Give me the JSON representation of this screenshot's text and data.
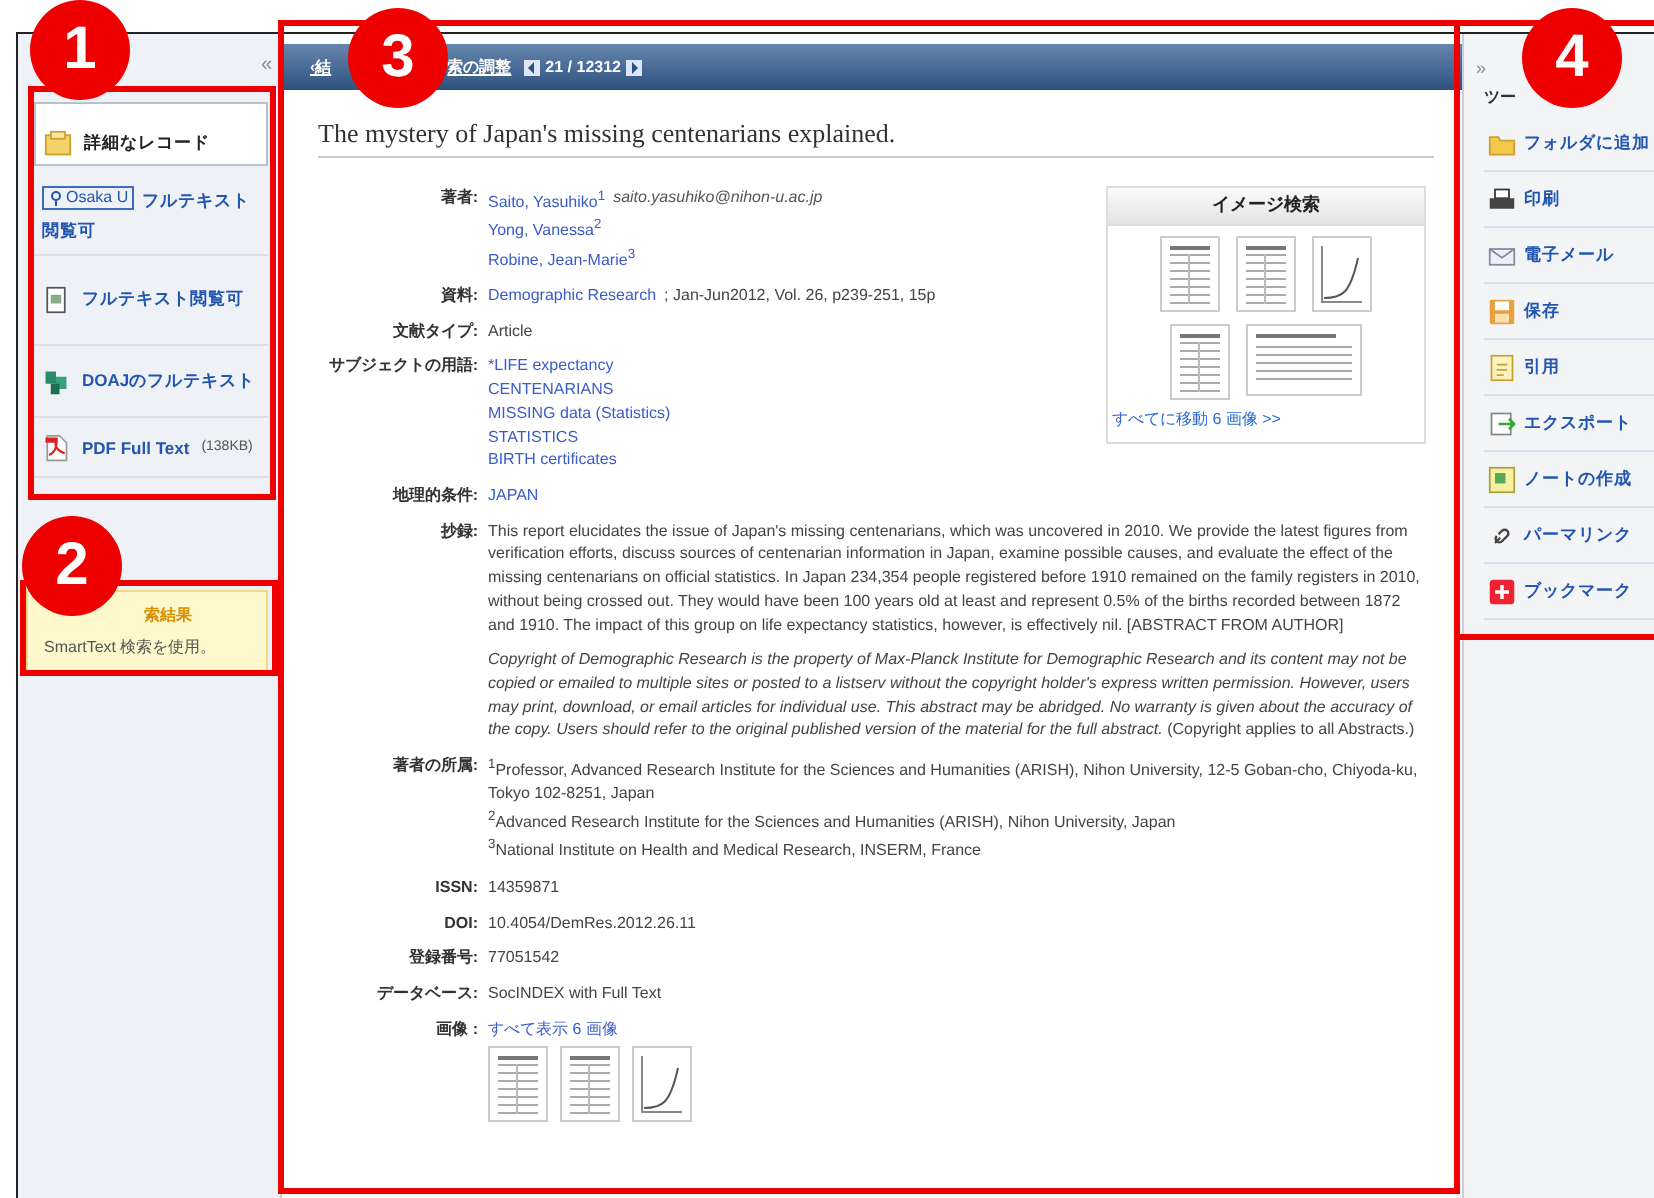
{
  "annotations": [
    {
      "number": "1"
    },
    {
      "number": "2"
    },
    {
      "number": "3"
    },
    {
      "number": "4"
    }
  ],
  "left_panel": {
    "collapse": "«",
    "items": [
      {
        "kind": "record",
        "label": "詳細なレコード",
        "selected": true
      },
      {
        "kind": "library",
        "badge": "Osaka U",
        "label": "フルテキスト閲覧可",
        "selected": false
      },
      {
        "kind": "fulltext",
        "label": "フルテキスト閲覧可",
        "selected": false
      },
      {
        "kind": "doaj",
        "label": "DOAJのフルテキスト",
        "selected": false
      },
      {
        "kind": "pdf",
        "label": "PDF Full Text",
        "size": "(138KB)",
        "selected": false
      }
    ],
    "notice": {
      "title": "索結果",
      "text": "SmartText 検索を使用。"
    }
  },
  "header": {
    "back_link": "‹結",
    "refine_link": "索の調整",
    "counter": "21 / 12312"
  },
  "title": "The mystery of Japan's missing centenarians explained.",
  "image_panel": {
    "title": "イメージ検索",
    "thumbnails": [
      {
        "kind": "table"
      },
      {
        "kind": "table"
      },
      {
        "kind": "chart"
      },
      {
        "kind": "table"
      },
      {
        "kind": "wide-table"
      }
    ],
    "link": "すべてに移動 6 画像 >>"
  },
  "fields": [
    {
      "label": "著者:",
      "lines": [
        [
          {
            "kind": "link",
            "text": "Saito, Yasuhiko$^{1}$"
          },
          {
            "kind": "email",
            "text": "saito.yasuhiko@nihon-u.ac.jp"
          }
        ],
        [
          {
            "kind": "link",
            "text": "Yong, Vanessa$^{2}$"
          }
        ],
        [
          {
            "kind": "link",
            "text": "Robine, Jean-Marie$^{3}$"
          }
        ]
      ]
    },
    {
      "label": "資料:",
      "lines": [
        [
          {
            "kind": "link",
            "text": "Demographic Research"
          },
          {
            "kind": "text",
            "text": "; Jan-Jun2012, Vol. 26, p239-251, 15p"
          }
        ]
      ]
    },
    {
      "label": "文献タイプ:",
      "lines": [
        [
          {
            "kind": "text",
            "text": "Article"
          }
        ]
      ]
    },
    {
      "label": "サブジェクトの用語:",
      "lines": [
        [
          {
            "kind": "link",
            "text": "*LIFE expectancy"
          }
        ],
        [
          {
            "kind": "link",
            "text": "CENTENARIANS"
          }
        ],
        [
          {
            "kind": "link",
            "text": "MISSING data (Statistics)"
          }
        ],
        [
          {
            "kind": "link",
            "text": "STATISTICS"
          }
        ],
        [
          {
            "kind": "link",
            "text": "BIRTH certificates"
          }
        ]
      ]
    },
    {
      "label": "地理的条件:",
      "lines": [
        [
          {
            "kind": "link",
            "text": "JAPAN"
          }
        ]
      ]
    },
    {
      "label": "抄録:",
      "lines": [
        [
          {
            "kind": "paragraph",
            "text": "This report elucidates the issue of Japan's missing centenarians, which was uncovered in 2010. We provide the latest figures from verification efforts, discuss sources of centenarian information in Japan, examine possible causes, and evaluate the effect of the missing centenarians on official statistics. In Japan 234,354 people registered before 1910 remained on the family registers in 2010, without being crossed out. They would have been 100 years old at least and represent 0.5% of the births recorded between 1872 and 1910. The impact of this group on life expectancy statistics, however, is effectively nil. [ABSTRACT FROM AUTHOR]"
          }
        ],
        [
          {
            "kind": "paragraph",
            "text": "*Copyright of Demographic Research is the property of Max-Planck Institute for Demographic Research and its content may not be copied or emailed to multiple sites or posted to a listserv without the copyright holder's express written permission. However, users may print, download, or email articles for individual use. This abstract may be abridged. No warranty is given about the accuracy of the copy. Users should refer to the original published version of the material for the full abstract.* (Copyright applies to all Abstracts.)"
          }
        ]
      ]
    },
    {
      "label": "著者の所属:",
      "lines": [
        [
          {
            "kind": "text",
            "text": "$^{1}$Professor, Advanced Research Institute for the Sciences and Humanities (ARISH), Nihon University, 12-5 Goban-cho, Chiyoda-ku, Tokyo 102-8251, Japan"
          }
        ],
        [
          {
            "kind": "text",
            "text": "$^{2}$Advanced Research Institute for the Sciences and Humanities (ARISH), Nihon University, Japan"
          }
        ],
        [
          {
            "kind": "text",
            "text": "$^{3}$National Institute on Health and Medical Research, INSERM, France"
          }
        ]
      ]
    },
    {
      "label": "ISSN:",
      "lines": [
        [
          {
            "kind": "text",
            "text": "14359871"
          }
        ]
      ]
    },
    {
      "label": "DOI:",
      "lines": [
        [
          {
            "kind": "text",
            "text": "10.4054/DemRes.2012.26.11"
          }
        ]
      ]
    },
    {
      "label": "登録番号:",
      "lines": [
        [
          {
            "kind": "text",
            "text": "77051542"
          }
        ]
      ]
    },
    {
      "label": "データベース:",
      "lines": [
        [
          {
            "kind": "text",
            "text": "SocINDEX with Full Text"
          }
        ]
      ]
    },
    {
      "label": "画像 :",
      "lines": [
        [
          {
            "kind": "link",
            "text": "すべて表示 6 画像"
          }
        ]
      ],
      "thumbnails": [
        {
          "kind": "table"
        },
        {
          "kind": "table"
        },
        {
          "kind": "chart"
        }
      ]
    }
  ],
  "tools": {
    "expand": "»",
    "title": "ツー",
    "items": [
      {
        "kind": "folder",
        "label": "フォルダに追加"
      },
      {
        "kind": "print",
        "label": "印刷"
      },
      {
        "kind": "email",
        "label": "電子メール"
      },
      {
        "kind": "save",
        "label": "保存"
      },
      {
        "kind": "cite",
        "label": "引用"
      },
      {
        "kind": "export",
        "label": "エクスポート"
      },
      {
        "kind": "note",
        "label": "ノートの作成"
      },
      {
        "kind": "link",
        "label": "パーマリンク"
      },
      {
        "kind": "bookmark",
        "label": "ブックマーク"
      }
    ]
  }
}
